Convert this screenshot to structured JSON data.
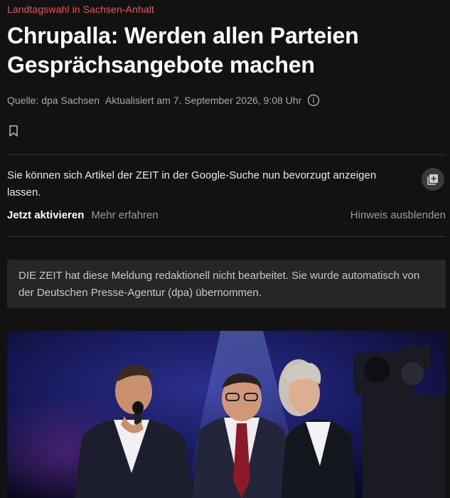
{
  "article": {
    "kicker": "Landtagswahl in Sachsen-Anhalt",
    "headline": "Chrupalla: Werden allen Parteien Gesprächsangebote machen",
    "source": "Quelle: dpa Sachsen",
    "updated": "Aktualisiert am 7. September 2026, 9:08 Uhr",
    "info_icon": "info-icon",
    "bookmark_icon": "bookmark-icon"
  },
  "google_notice": {
    "text": "Sie können sich Artikel der ZEIT in der Google-Suche nun bevorzugt anzeigen lassen.",
    "activate_label": "Jetzt aktivieren",
    "learn_more_label": "Mehr erfahren",
    "dismiss_label": "Hinweis ausblenden",
    "icon": "add-to-feed-icon"
  },
  "dpa_notice": {
    "text": "DIE ZEIT hat diese Meldung redaktionell nicht bearbeitet. Sie wurde automatisch von der Deutschen Presse-Agentur (dpa) übernommen."
  },
  "colors": {
    "background": "#121212",
    "kicker": "#ef5350",
    "headline": "#ffffff",
    "muted": "#a8a8a8",
    "box": "#262626"
  }
}
